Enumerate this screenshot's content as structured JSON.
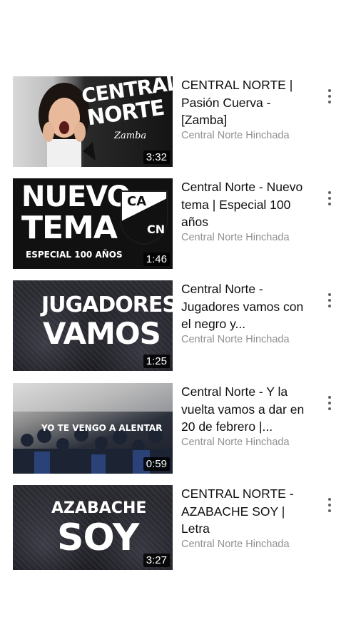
{
  "videos": [
    {
      "title": "CENTRAL NORTE | Pasión Cuerva - [Zamba]",
      "channel": "Central Norte Hinchada",
      "duration": "3:32",
      "thumb_text": [
        "CENTRAL",
        "NORTE",
        "Zamba"
      ],
      "thumb_icon": "woman-surprised-thumbnail"
    },
    {
      "title": "Central Norte - Nuevo tema | Especial 100 años",
      "channel": "Central Norte Hinchada",
      "duration": "1:46",
      "thumb_text": [
        "NUEVO",
        "TEMA",
        "ESPECIAL 100 AÑOS",
        "CA",
        "CN"
      ],
      "thumb_icon": "club-crest-thumbnail"
    },
    {
      "title": "Central Norte - Jugadores vamos con el negro y...",
      "channel": "Central Norte Hinchada",
      "duration": "1:25",
      "thumb_text": [
        "JUGADORES",
        "VAMOS"
      ],
      "thumb_icon": "stadium-crowd-thumbnail"
    },
    {
      "title": "Central Norte - Y la vuelta vamos a dar en 20 de febrero |...",
      "channel": "Central Norte Hinchada",
      "duration": "0:59",
      "thumb_text": [
        "YO TE VENGO A ALENTAR"
      ],
      "thumb_icon": "fans-tribune-thumbnail"
    },
    {
      "title": "CENTRAL NORTE - AZABACHE SOY | Letra",
      "channel": "Central Norte Hinchada",
      "duration": "3:27",
      "thumb_text": [
        "AZABACHE",
        "SOY"
      ],
      "thumb_icon": "stadium-night-thumbnail"
    }
  ],
  "colors": {
    "title": "#0f0f0f",
    "channel": "#909090",
    "background": "#ffffff",
    "duration_bg": "#000000"
  }
}
